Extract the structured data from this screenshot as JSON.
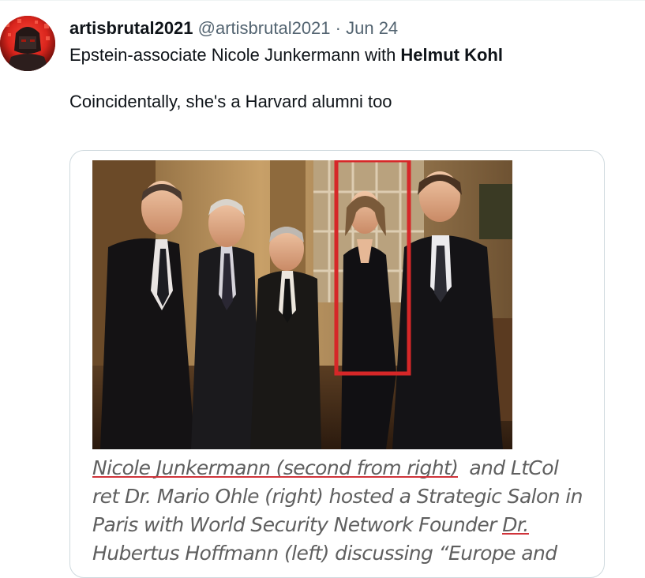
{
  "tweet": {
    "display_name": "artisbrutal2021",
    "handle": "@artisbrutal2021",
    "separator": "·",
    "date": "Jun 24",
    "text_part1": "Epstein-associate Nicole Junkermann with ",
    "text_mention": "Helmut Kohl",
    "text_line2": "Coincidentally, she's a Harvard alumni too"
  },
  "media": {
    "caption_highlight": "Nicole Junkermann (second from right)",
    "caption_rest_1": "and LtCol",
    "caption_line2": "ret Dr. Mario Ohle (right) hosted a Strategic Salon in",
    "caption_line3_start": "Paris with World Security Network Founder ",
    "caption_line3_underlined": "Dr.",
    "caption_line4": "Hubertus Hoffmann (left) discussing “Europe and"
  },
  "colors": {
    "accent_red": "#d0333a",
    "highlight_box": "#d62728",
    "secondary_text": "#536471"
  }
}
